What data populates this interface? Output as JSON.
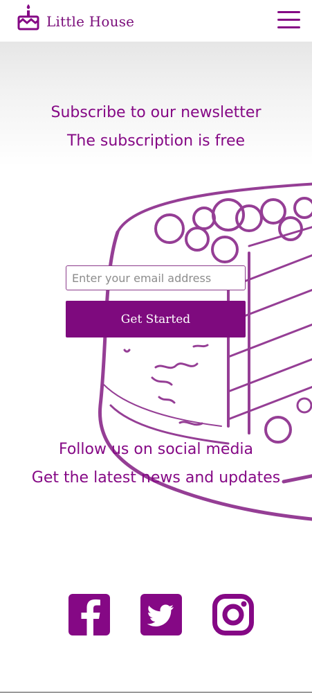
{
  "brand": {
    "name": "Little House"
  },
  "newsletter": {
    "title": "Subscribe to our newsletter",
    "subtitle": "The subscription is free",
    "email_placeholder": "Enter your email address",
    "button_label": "Get Started"
  },
  "social": {
    "title": "Follow us on social media",
    "subtitle": "Get the latest news and updates",
    "links": [
      {
        "icon": "facebook-icon"
      },
      {
        "icon": "twitter-icon"
      },
      {
        "icon": "instagram-icon"
      }
    ]
  },
  "colors": {
    "brand": "#850885",
    "button": "#7e0a7e"
  }
}
